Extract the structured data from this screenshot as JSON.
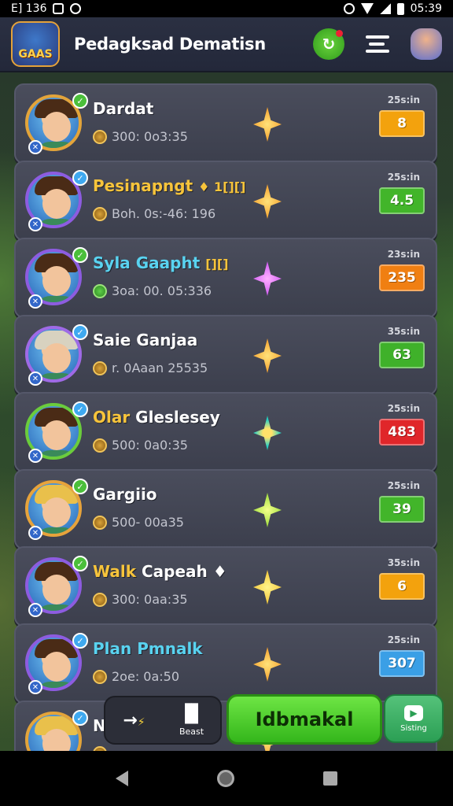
{
  "status_bar": {
    "left_text": "E] 136",
    "time": "05:39"
  },
  "header": {
    "logo_text": "GAAS",
    "title": "Pedagksad Dematisn",
    "icons": [
      "refresh-icon",
      "menu-icon",
      "profile-icon"
    ]
  },
  "players": [
    {
      "name": "Dardat",
      "stats": "300: 0o3:35",
      "time": "25s:in",
      "score": "8",
      "score_color": "#f3a20d",
      "star": "orange",
      "name_style": "white",
      "avatar": "c1",
      "hair": "brown"
    },
    {
      "name": "Pesinapngt",
      "name_suffix": "♦ 1[][]",
      "stats": "Boh. 0s:-46: 196",
      "time": "25s:in",
      "score": "4.5",
      "score_color": "#42b52a",
      "star": "orange",
      "name_style": "gold",
      "avatar": "c2",
      "hair": "brown"
    },
    {
      "name": "Syla Gaapht",
      "name_suffix": "[][]",
      "stats": "3oa: 00. 05:336",
      "time": "23s:in",
      "score": "235",
      "score_color": "#f07f12",
      "star": "purple",
      "name_style": "teal",
      "avatar": "c3",
      "hair": "brown"
    },
    {
      "name": "Saie Ganjaa",
      "stats": "r. 0Aaan 25535",
      "time": "35s:in",
      "score": "63",
      "score_color": "#3fb12a",
      "star": "orange",
      "name_style": "white",
      "avatar": "c4",
      "hair": "grey"
    },
    {
      "name": "Olar Gleslesey",
      "stats": "500: 0a0:35",
      "time": "25s:in",
      "score": "483",
      "score_color": "#e0262a",
      "star": "teal",
      "name_style": "mix",
      "name_first": "Olar",
      "name_rest": " Gleslesey",
      "avatar": "c5",
      "hair": "brown"
    },
    {
      "name": "Gargiio",
      "stats": "500- 00a35",
      "time": "25s:in",
      "score": "39",
      "score_color": "#42b52a",
      "star": "lime",
      "name_style": "white",
      "avatar": "c6",
      "hair": "blond"
    },
    {
      "name": "Walk Capeah",
      "name_first": "Walk",
      "name_rest": " Capeah ♦",
      "stats": "300: 0aa:35",
      "time": "35s:in",
      "score": "6",
      "score_color": "#f3a20d",
      "star": "yellow",
      "name_style": "mix",
      "avatar": "c7",
      "hair": "brown"
    },
    {
      "name": "Plan Pmnalk",
      "stats": "2oe: 0a:50",
      "time": "25s:in",
      "score": "307",
      "score_color": "#3a9fe6",
      "star": "orange",
      "name_style": "teal",
      "avatar": "c8",
      "hair": "brown"
    },
    {
      "name": "Ne",
      "stats": "",
      "time": "",
      "score": "",
      "score_color": "#3a9fe6",
      "star": "orange",
      "name_style": "white",
      "avatar": "c9",
      "hair": "blond"
    }
  ],
  "action_bar": {
    "left_glyph": "→",
    "left_glyph2": "⚡",
    "right_label": "Beast",
    "main_label": "Idbmakal",
    "side_label": "Sisting"
  },
  "navbar": {
    "icons": [
      "back-icon",
      "home-icon",
      "recents-icon"
    ]
  }
}
